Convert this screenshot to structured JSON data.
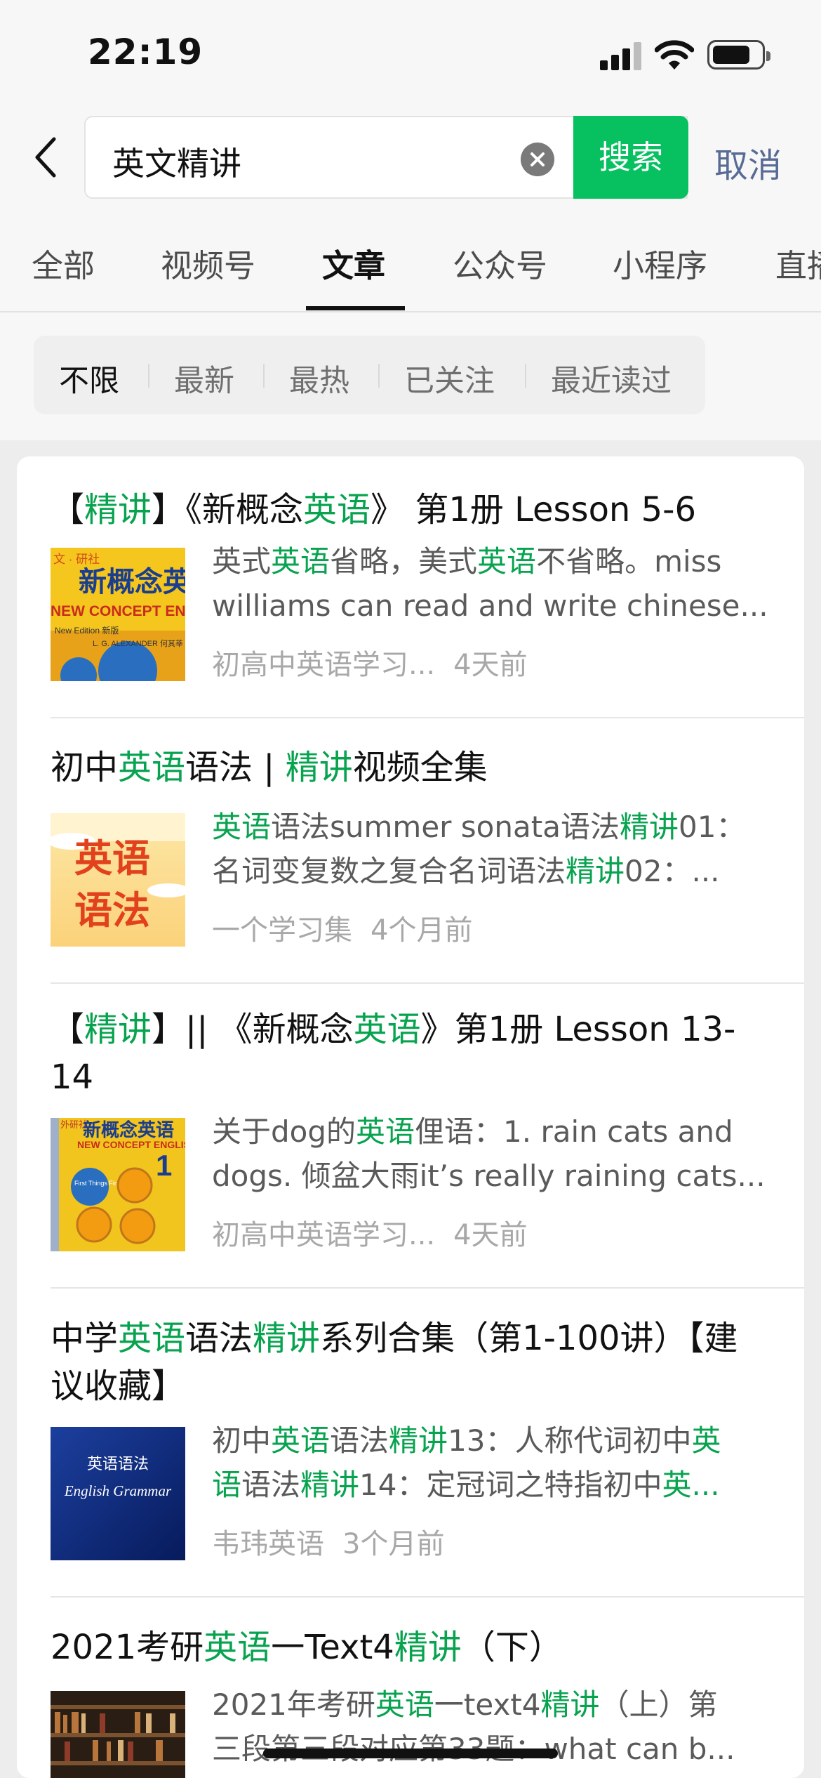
{
  "status": {
    "time": "22:19"
  },
  "search": {
    "query": "英文精讲",
    "button_label": "搜索",
    "cancel_label": "取消"
  },
  "tabs": [
    "全部",
    "视频号",
    "文章",
    "公众号",
    "小程序",
    "直播"
  ],
  "active_tab": "文章",
  "filters": [
    "不限",
    "最新",
    "最热",
    "已关注",
    "最近读过"
  ],
  "active_filter": "不限",
  "colors": {
    "accent_green": "#07c160",
    "highlight_green": "#07a34f",
    "link_blue": "#576b95"
  },
  "results": [
    {
      "title": [
        [
          "【",
          ""
        ],
        [
          "精讲",
          "hl"
        ],
        [
          "】《新概念",
          ""
        ],
        [
          "英语",
          "hl"
        ],
        [
          "》 第1册 Lesson 5-6",
          ""
        ]
      ],
      "desc_line1": [
        [
          "英式",
          ""
        ],
        [
          "英语",
          "hl"
        ],
        [
          "省略，美式",
          ""
        ],
        [
          "英语",
          "hl"
        ],
        [
          "不省略。miss",
          ""
        ]
      ],
      "desc_line2": [
        [
          "williams can read and write chinese...",
          ""
        ]
      ],
      "source": "初高中英语学习...",
      "time": "4天前",
      "thumb": "new-concept-english-book-yellow",
      "thumb_text": {
        "top": "新概念英",
        "sub": "NEW CONCEPT ENGLISH",
        "badge": "New Edition 新版",
        "author": "L. G. ALEXANDER 何其莘 著",
        "corner": "文 · 研社"
      }
    },
    {
      "title": [
        [
          "初中",
          ""
        ],
        [
          "英语",
          "hl"
        ],
        [
          "语法 | ",
          ""
        ],
        [
          "精讲",
          "hl"
        ],
        [
          "视频全集",
          ""
        ]
      ],
      "desc_line1": [
        [
          "英语",
          "hl"
        ],
        [
          "语法summer sonata语法",
          ""
        ],
        [
          "精讲",
          "hl"
        ],
        [
          "01：",
          ""
        ]
      ],
      "desc_line2": [
        [
          "名词变复数之复合名词语法",
          ""
        ],
        [
          "精讲",
          "hl"
        ],
        [
          "02：...",
          ""
        ]
      ],
      "source": "一个学习集",
      "time": "4个月前",
      "thumb": "english-grammar-orange",
      "thumb_text": {
        "line1": "英语",
        "line2": "语法"
      }
    },
    {
      "title": [
        [
          "【",
          ""
        ],
        [
          "精讲",
          "hl"
        ],
        [
          "】|| 《新概念",
          ""
        ],
        [
          "英语",
          "hl"
        ],
        [
          "》第1册 Lesson 13-14",
          ""
        ]
      ],
      "desc_line1": [
        [
          "关于dog的",
          ""
        ],
        [
          "英语",
          "hl"
        ],
        [
          "俚语：1. rain cats and",
          ""
        ]
      ],
      "desc_line2": [
        [
          "dogs. 倾盆大雨it’s really raining cats...",
          ""
        ]
      ],
      "source": "初高中英语学习...",
      "time": "4天前",
      "thumb": "new-concept-english-book-1",
      "thumb_text": {
        "top": "新概念英语",
        "sub": "NEW CONCEPT ENGLISH",
        "num": "1",
        "badge": "First Things First 英语初阶",
        "corner": "外研社"
      }
    },
    {
      "title": [
        [
          "中学",
          ""
        ],
        [
          "英语",
          "hl"
        ],
        [
          "语法",
          ""
        ],
        [
          "精讲",
          "hl"
        ],
        [
          "系列合集（第1-100讲）【建议收藏】",
          ""
        ]
      ],
      "desc_line1": [
        [
          "初中",
          ""
        ],
        [
          "英语",
          "hl"
        ],
        [
          "语法",
          ""
        ],
        [
          "精讲",
          "hl"
        ],
        [
          "13：人称代词初中",
          ""
        ],
        [
          "英",
          "hl"
        ]
      ],
      "desc_line2": [
        [
          "语",
          "hl"
        ],
        [
          "语法",
          ""
        ],
        [
          "精讲",
          "hl"
        ],
        [
          "14：定冠词之特指初中",
          ""
        ],
        [
          "英...",
          "hl"
        ]
      ],
      "source": "韦玮英语",
      "time": "3个月前",
      "thumb": "english-grammar-blue",
      "thumb_text": {
        "line1": "英语语法",
        "line2": "English Grammar"
      }
    },
    {
      "title": [
        [
          "2021考研",
          ""
        ],
        [
          "英语",
          "hl"
        ],
        [
          "一Text4",
          ""
        ],
        [
          "精讲",
          "hl"
        ],
        [
          "（下）",
          ""
        ]
      ],
      "desc_line1": [
        [
          "2021年考研",
          ""
        ],
        [
          "英语",
          "hl"
        ],
        [
          "一text4",
          ""
        ],
        [
          "精讲",
          "hl"
        ],
        [
          "（上）第",
          ""
        ]
      ],
      "desc_line2": [
        [
          "三段第三段对应第33题：what can b...",
          ""
        ]
      ],
      "source": "",
      "time": "",
      "thumb": "bookshelf-library",
      "thumb_text": {}
    }
  ]
}
